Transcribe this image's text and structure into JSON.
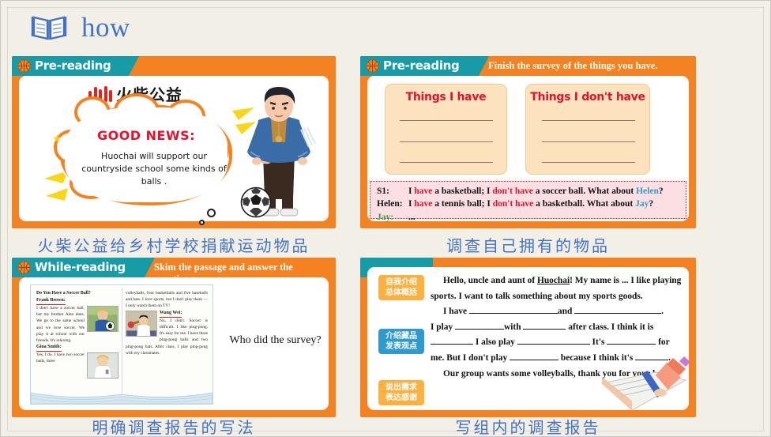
{
  "header": {
    "icon": "open-book-icon",
    "title": "how",
    "title_color": "#4472c4"
  },
  "theme": {
    "teal": "#179ba6",
    "orange": "#f58220",
    "red": "#e8112d",
    "blue": "#2e9ad0",
    "page_bg": "#f2efe7",
    "tag_orange": "#fbb040"
  },
  "panels": {
    "pre_reading_news": {
      "stage_label": "Pre-reading",
      "icon": "basketball-icon",
      "logo_cn": "火柴公益",
      "good_news_label": "GOOD NEWS:",
      "cloud_text": "Huochai will support our countryside school some kinds of balls .",
      "caption": "火柴公益给乡村学校捐献运动物品"
    },
    "pre_reading_survey": {
      "stage_label": "Pre-reading",
      "icon": "basketball-icon",
      "instruction": "Finish the survey of the things you have.",
      "box_have_title": "Things I have",
      "box_dont_have_title": "Things I don't have",
      "dialog": [
        {
          "speaker": "S1:",
          "speaker_color": "#111111",
          "parts": [
            {
              "t": "I ",
              "c": "black"
            },
            {
              "t": "have",
              "c": "red"
            },
            {
              "t": " a basketball; I ",
              "c": "black"
            },
            {
              "t": "don't have",
              "c": "red"
            },
            {
              "t": " a soccer ball. What about ",
              "c": "black"
            },
            {
              "t": "Helen",
              "c": "blue"
            },
            {
              "t": "?",
              "c": "black"
            }
          ]
        },
        {
          "speaker": "Helen:",
          "speaker_color": "#111111",
          "parts": [
            {
              "t": "I ",
              "c": "black"
            },
            {
              "t": "have",
              "c": "red"
            },
            {
              "t": " a tennis ball; I ",
              "c": "black"
            },
            {
              "t": "don't have",
              "c": "red"
            },
            {
              "t": " a basketball. What about ",
              "c": "black"
            },
            {
              "t": "Jay",
              "c": "blue"
            },
            {
              "t": "?",
              "c": "black"
            }
          ]
        },
        {
          "speaker": "Jay:",
          "speaker_color": "#2f9e5e",
          "parts": [
            {
              "t": "...",
              "c": "black"
            }
          ]
        }
      ],
      "caption": "调查自己拥有的物品"
    },
    "while_reading": {
      "stage_label": "While-reading",
      "icon": "basketball-icon",
      "instruction": "Skim the passage and answer the questions.",
      "question": "Who did the survey?",
      "textbook": {
        "title": "Do You Have a Soccer Ball?",
        "entries": [
          {
            "name": "Frank Brown:",
            "text": "I don't have a soccer ball, but my brother Alan does. We go to the same school and we love soccer. We play it at school with our friends. It's relaxing."
          },
          {
            "name": "Gina Smith:",
            "text": "Yes, I do. I have two soccer balls, three volleyballs, four basketballs and five baseballs and bats. I love sports, but I don't play them — I only watch them on TV!"
          },
          {
            "name": "Wang Wei:",
            "text": "No, I don't. Soccer is difficult. I like ping-pong. It's easy for me. I have three ping-pong balls and two ping-pong bats. After class, I play ping-pong with my classmates."
          }
        ]
      },
      "caption": "明确调查报告的写法"
    },
    "writing": {
      "tags": [
        {
          "label": "自我介绍\n总体概括",
          "line1": "自我介绍",
          "line2": "总体概括",
          "color": "orange"
        },
        {
          "label": "介绍藏品\n发表观点",
          "line1": "介绍藏品",
          "line2": "发表观点",
          "color": "blue"
        },
        {
          "label": "说出需求\n表达感谢",
          "line1": "说出需求",
          "line2": "表达感谢",
          "color": "orange"
        }
      ],
      "paragraphs": [
        "Hello, uncle and aunt of Huochai! My name is ... I like playing sports. I want to talk something about my sports goods.",
        "I have ____________and ______________.",
        "I play _______with ________ after class. I think it is________ I also play ____________ It's _________ for me. But I don't play ________ because I think it's ______.",
        "Our group wants some volleyballs, thank you for your help."
      ],
      "icon": "notebook-pencil-icon",
      "caption": "写组内的调查报告"
    }
  }
}
